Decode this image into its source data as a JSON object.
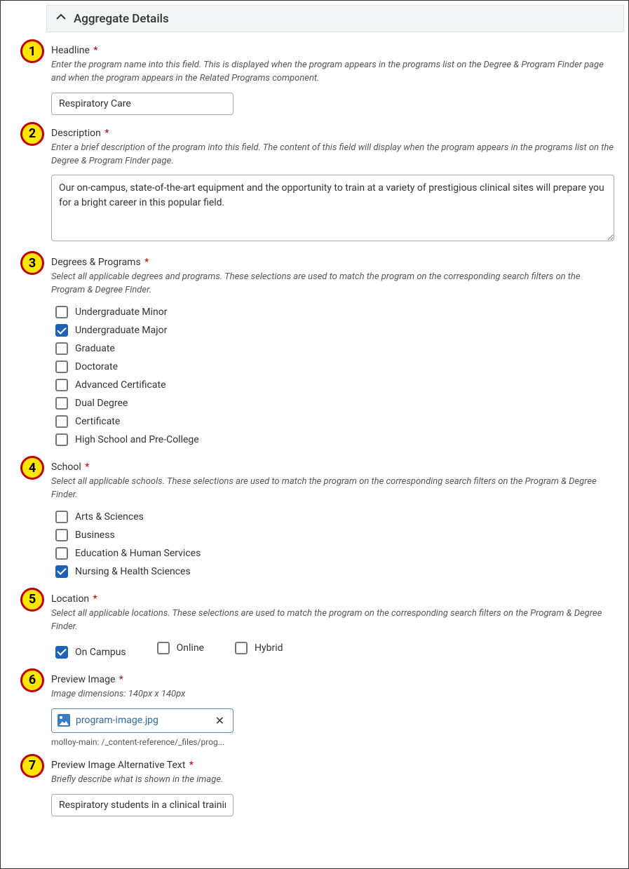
{
  "section": {
    "title": "Aggregate Details"
  },
  "fields": {
    "headline": {
      "label": "Headline",
      "help": "Enter the program name into this field. This is displayed when the program appears in the programs list on the Degree & Program Finder page and when the program appears in the Related Programs component.",
      "value": "Respiratory Care"
    },
    "description": {
      "label": "Description",
      "help": "Enter a brief description of the program into this field. The content of this field will display when the program appears in the programs list on the Degree & Program Finder page.",
      "value": "Our on-campus, state-of-the-art equipment and the opportunity to train at a variety of prestigious clinical sites will prepare you for a bright career in this popular field."
    },
    "degrees": {
      "label": "Degrees & Programs",
      "help": "Select all applicable degrees and programs. These selections are used to match the program on the corresponding search filters on the Program & Degree Finder.",
      "options": [
        {
          "label": "Undergraduate Minor",
          "checked": false
        },
        {
          "label": "Undergraduate Major",
          "checked": true
        },
        {
          "label": "Graduate",
          "checked": false
        },
        {
          "label": "Doctorate",
          "checked": false
        },
        {
          "label": "Advanced Certificate",
          "checked": false
        },
        {
          "label": "Dual Degree",
          "checked": false
        },
        {
          "label": "Certificate",
          "checked": false
        },
        {
          "label": "High School and Pre-College",
          "checked": false
        }
      ]
    },
    "school": {
      "label": "School",
      "help": "Select all applicable schools. These selections are used to match the program on the corresponding search filters on the Program & Degree Finder.",
      "options": [
        {
          "label": "Arts & Sciences",
          "checked": false
        },
        {
          "label": "Business",
          "checked": false
        },
        {
          "label": "Education & Human Services",
          "checked": false
        },
        {
          "label": "Nursing & Health Sciences",
          "checked": true
        }
      ]
    },
    "location": {
      "label": "Location",
      "help": "Select all applicable locations. These selections are used to match the program on the corresponding search filters on the Program & Degree Finder.",
      "options": [
        {
          "label": "On Campus",
          "checked": true
        },
        {
          "label": "Online",
          "checked": false
        },
        {
          "label": "Hybrid",
          "checked": false
        }
      ]
    },
    "preview_image": {
      "label": "Preview Image",
      "help": "Image dimensions: 140px x 140px",
      "filename": "program-image.jpg",
      "path": "molloy-main: /_content-reference/_files/prog..."
    },
    "alt_text": {
      "label": "Preview Image Alternative Text",
      "help": "Briefly describe what is shown in the image.",
      "value": "Respiratory students in a clinical training"
    }
  },
  "badges": [
    "1",
    "2",
    "3",
    "4",
    "5",
    "6",
    "7"
  ],
  "required_marker": "*"
}
